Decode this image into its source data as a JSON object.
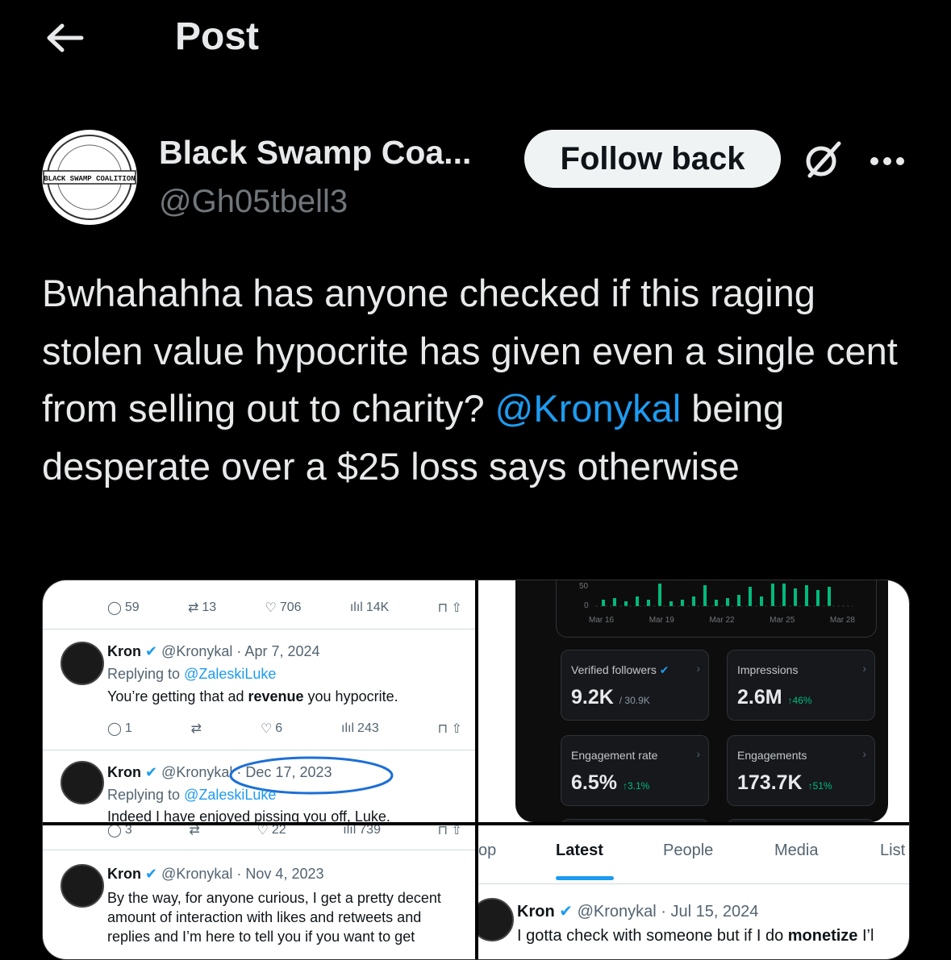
{
  "header": {
    "title": "Post"
  },
  "author": {
    "display_name": "Black Swamp Coa...",
    "handle": "@Gh05tbell3",
    "follow_label": "Follow back",
    "avatar_text_main": "BLACK SWAMP COALITION"
  },
  "post": {
    "text_before": "Bwhahahha has anyone checked if this raging stolen value hypocrite has given even a single cent from selling out to charity? ",
    "mention": "@Kronykal",
    "text_after": " being desperate over a $25 loss says otherwise"
  },
  "media": {
    "q1": {
      "top_actions": {
        "replies": "59",
        "retweets": "13",
        "likes": "706",
        "views": "14K"
      },
      "tweet1": {
        "name": "Kron",
        "handle_date": "@Kronykal · Apr 7, 2024",
        "reply_prefix": "Replying to ",
        "reply_to": "@ZaleskiLuke",
        "text_a": "You’re getting that ad ",
        "text_bold": "revenue",
        "text_b": " you hypocrite.",
        "actions": {
          "replies": "1",
          "retweets": "",
          "likes": "6",
          "views": "243"
        }
      },
      "tweet2": {
        "name": "Kron",
        "handle_date": "@Kronykal · Dec 17, 2023",
        "reply_prefix": "Replying to ",
        "reply_to": "@ZaleskiLuke",
        "text": "Indeed I have enjoyed pissing you off, Luke."
      }
    },
    "q2": {
      "axis_top": "50",
      "axis_zero": "0",
      "x_ticks": [
        "Mar 16",
        "Mar 19",
        "Mar 22",
        "Mar 25",
        "Mar 28"
      ],
      "cards": [
        {
          "label": "Verified followers",
          "value": "9.2K",
          "sub": "/ 30.9K",
          "pct": ""
        },
        {
          "label": "Impressions",
          "value": "2.6M",
          "sub": "",
          "pct": "↑46%"
        },
        {
          "label": "Engagement rate",
          "value": "6.5%",
          "sub": "",
          "pct": "↑3.1%"
        },
        {
          "label": "Engagements",
          "value": "173.7K",
          "sub": "",
          "pct": "↑51%"
        }
      ]
    },
    "q3": {
      "top_actions": {
        "replies": "3",
        "retweets": "",
        "likes": "22",
        "views": "739"
      },
      "tweet": {
        "name": "Kron",
        "handle_date": "@Kronykal · Nov 4, 2023",
        "text": "By the way, for anyone curious, I get a pretty decent amount of interaction with likes and retweets and replies and I’m here to tell you if you want to get"
      }
    },
    "q4": {
      "tabs": [
        "op",
        "Latest",
        "People",
        "Media",
        "List"
      ],
      "tweet": {
        "name": "Kron",
        "handle_date": "@Kronykal · Jul 15, 2024",
        "text_a": "I gotta check with someone but if I do ",
        "text_bold": "monetize",
        "text_b": " I’l"
      }
    }
  }
}
